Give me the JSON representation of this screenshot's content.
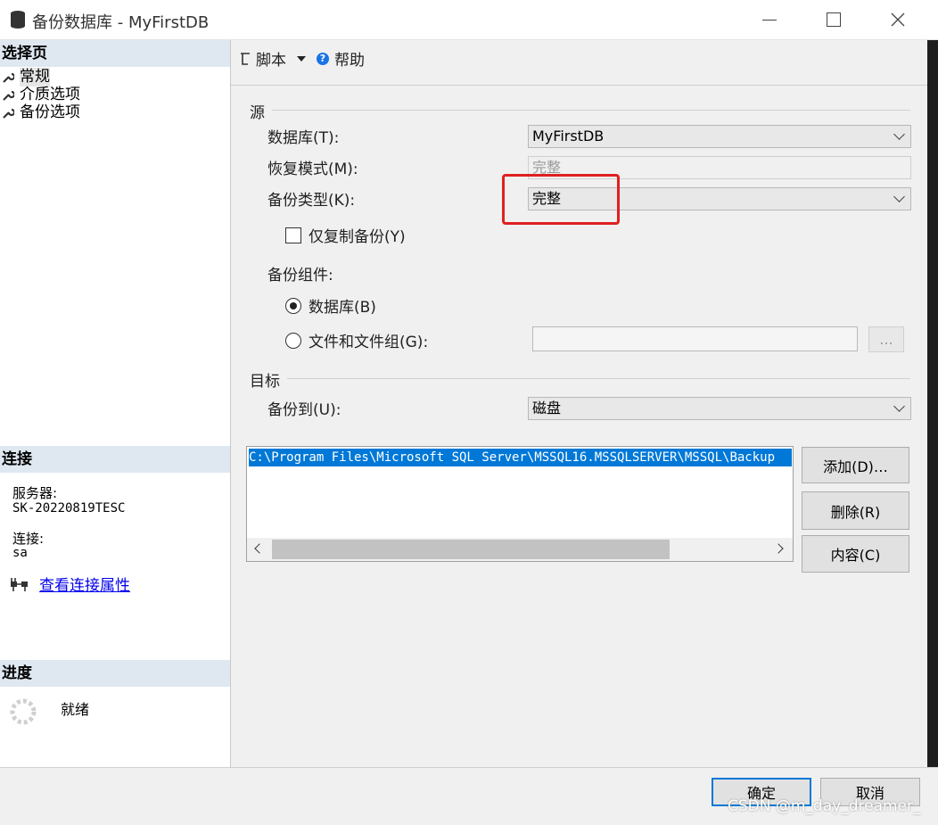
{
  "window": {
    "title": "备份数据库 - MyFirstDB",
    "minimize_icon": "minimize-icon",
    "maximize_icon": "maximize-icon",
    "close_icon": "close-icon"
  },
  "left": {
    "select_page_header": "选择页",
    "pages": [
      {
        "label": "常规",
        "icon": "wrench-icon"
      },
      {
        "label": "介质选项",
        "icon": "wrench-icon"
      },
      {
        "label": "备份选项",
        "icon": "wrench-icon"
      }
    ],
    "connection_header": "连接",
    "server_label": "服务器:",
    "server_value": "SK-20220819TESC",
    "connection_label": "连接:",
    "connection_value": "sa",
    "view_props_link": "查看连接属性",
    "progress_header": "进度",
    "progress_status": "就绪"
  },
  "toolbar": {
    "script_label": "脚本",
    "help_label": "帮助"
  },
  "source": {
    "group_label": "源",
    "database_label": "数据库(T):",
    "database_value": "MyFirstDB",
    "recovery_label": "恢复模式(M):",
    "recovery_value": "完整",
    "backup_type_label": "备份类型(K):",
    "backup_type_value": "完整",
    "copy_only_label": "仅复制备份(Y)",
    "component_label": "备份组件:",
    "radio_database": "数据库(B)",
    "radio_files": "文件和文件组(G):",
    "files_value": "",
    "browse_label": "..."
  },
  "destination": {
    "group_label": "目标",
    "backup_to_label": "备份到(U):",
    "backup_to_value": "磁盘",
    "paths": [
      "C:\\Program Files\\Microsoft SQL Server\\MSSQL16.MSSQLSERVER\\MSSQL\\Backup"
    ],
    "add_button": "添加(D)…",
    "remove_button": "删除(R)",
    "contents_button": "内容(C)"
  },
  "footer": {
    "ok_button": "确定",
    "cancel_button": "取消",
    "watermark": "CSDN @m_day_dreamer_"
  },
  "colors": {
    "highlight_box": "#e02020",
    "selection": "#0078d7",
    "section_header": "#dfe8f1"
  }
}
